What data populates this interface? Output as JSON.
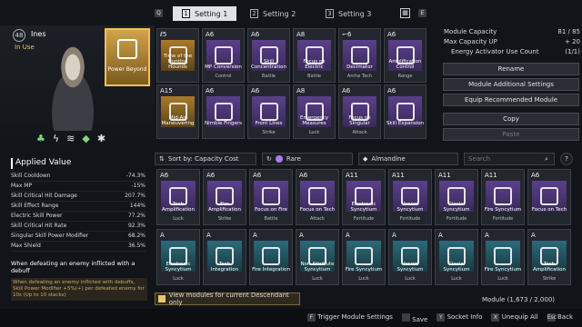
{
  "tabs": {
    "left_key": "Q",
    "right_key": "E",
    "items": [
      {
        "num": "1",
        "label": "Setting 1"
      },
      {
        "num": "2",
        "label": "Setting 2"
      },
      {
        "num": "3",
        "label": "Setting 3"
      }
    ]
  },
  "character": {
    "level": "48",
    "name": "Ines",
    "status": "In Use"
  },
  "main_module": {
    "name": "Power Beyond"
  },
  "equipped": [
    {
      "cap": "ℓ5",
      "name": "Time of the Hunting Hounds",
      "cat": "",
      "style": "gold"
    },
    {
      "cap": "A6",
      "name": "MP Conversion",
      "cat": "Control",
      "style": "purple"
    },
    {
      "cap": "A6",
      "name": "Skill Concentration",
      "cat": "Battle",
      "style": "purple"
    },
    {
      "cap": "A8",
      "name": "Focus on Electric",
      "cat": "Battle",
      "style": "purple"
    },
    {
      "cap": "⌐6",
      "name": "Decimator",
      "cat": "Arche Tech",
      "style": "purple"
    },
    {
      "cap": "A6",
      "name": "Amplification Control",
      "cat": "Range",
      "style": "purple"
    },
    {
      "cap": "A15",
      "name": "Mid-Air Maneuvering",
      "cat": "",
      "style": "gold"
    },
    {
      "cap": "A6",
      "name": "Nimble Fingers",
      "cat": "",
      "style": "purple"
    },
    {
      "cap": "A6",
      "name": "Front Lines",
      "cat": "Strike",
      "style": "purple"
    },
    {
      "cap": "A8",
      "name": "Emergency Measures",
      "cat": "Luck",
      "style": "purple"
    },
    {
      "cap": "A6",
      "name": "Focus on Singular",
      "cat": "Attack",
      "style": "purple"
    },
    {
      "cap": "A6",
      "name": "Skill Expansion",
      "cat": "",
      "style": "purple"
    }
  ],
  "capacity": {
    "module_capacity_label": "Module Capacity",
    "module_capacity_value": "81 / 85",
    "max_capacity_label": "Max Capacity UP",
    "max_capacity_value": "+ 20",
    "activator_label": "Energy Activator Use Count",
    "activator_value": "(1/1)"
  },
  "actions": [
    "Rename",
    "Module Additional Settings",
    "Equip Recommended Module",
    "Copy",
    "Paste"
  ],
  "applied": {
    "title": "Applied Value",
    "rows": [
      {
        "k": "Skill Cooldown",
        "v": "-74.3%"
      },
      {
        "k": "Max MP",
        "v": "-15%"
      },
      {
        "k": "Skill Critical Hit Damage",
        "v": "207.7%"
      },
      {
        "k": "Skill Effect Range",
        "v": "144%"
      },
      {
        "k": "Electric Skill Power",
        "v": "77.2%"
      },
      {
        "k": "Skill Critical Hit Rate",
        "v": "92.3%"
      },
      {
        "k": "Singular Skill Power Modifier",
        "v": "68.2%"
      },
      {
        "k": "Max Shield",
        "v": "36.5%"
      }
    ],
    "effect_title": "When defeating an enemy inflicted with a debuff",
    "effect_desc": "When defeating an enemy inflicted with debuffs, Skill Power Modifier +5%(+) per defeated enemy for 10s (Up to 10 stacks)"
  },
  "filter": {
    "sort": "Sort by: Capacity Cost",
    "rarity": "Rare",
    "socket": "Almandine",
    "search_placeholder": "Search"
  },
  "inventory": [
    {
      "cap": "A6",
      "name": "Tech Amplification",
      "cat": "Luck",
      "style": "purple"
    },
    {
      "cap": "A6",
      "name": "Fire Amplification",
      "cat": "Strike",
      "style": "purple"
    },
    {
      "cap": "A6",
      "name": "Focus on Fire",
      "cat": "Battle",
      "style": "purple"
    },
    {
      "cap": "A6",
      "name": "Focus on Tech",
      "cat": "Attack",
      "style": "purple"
    },
    {
      "cap": "A11",
      "name": "Electronic Syncytium",
      "cat": "Fortitude",
      "style": "purple"
    },
    {
      "cap": "A11",
      "name": "Venom Syncytium",
      "cat": "Fortitude",
      "style": "purple"
    },
    {
      "cap": "A11",
      "name": "Glacial Syncytium",
      "cat": "Fortitude",
      "style": "purple"
    },
    {
      "cap": "A11",
      "name": "Fire Syncytium",
      "cat": "Fortitude",
      "style": "purple"
    },
    {
      "cap": "A6",
      "name": "Focus on Tech",
      "cat": "",
      "style": "purple"
    },
    {
      "cap": "A",
      "name": "Electronic Syncytium",
      "cat": "Luck",
      "style": "cyan"
    },
    {
      "cap": "A",
      "name": "Tech Integration",
      "cat": "",
      "style": "cyan"
    },
    {
      "cap": "A",
      "name": "Fire Integration",
      "cat": "",
      "style": "cyan"
    },
    {
      "cap": "A",
      "name": "Non-Attribute Syncytium",
      "cat": "Luck",
      "style": "cyan"
    },
    {
      "cap": "A",
      "name": "Fire Syncytium",
      "cat": "Luck",
      "style": "cyan"
    },
    {
      "cap": "A",
      "name": "Venom Syncytium",
      "cat": "Luck",
      "style": "cyan"
    },
    {
      "cap": "A",
      "name": "Glacial Syncytium",
      "cat": "Luck",
      "style": "cyan"
    },
    {
      "cap": "A",
      "name": "Fire Syncytium",
      "cat": "Luck",
      "style": "cyan"
    },
    {
      "cap": "A",
      "name": "Tech Amplification",
      "cat": "Strike",
      "style": "cyan"
    }
  ],
  "view_toggle": "View modules for current Descendant only",
  "module_count": "Module (1,673 / 2,000)",
  "footer": [
    {
      "key": "F",
      "label": "Trigger Module Settings"
    },
    {
      "key": "",
      "label": "Save"
    },
    {
      "key": "Y",
      "label": "Socket Info"
    },
    {
      "key": "X",
      "label": "Unequip All"
    },
    {
      "key": "Esc",
      "label": "Back"
    }
  ],
  "colors": {
    "purple": "#5b3f8a",
    "gold": "#c79a3a",
    "accent": "#e8c86a"
  }
}
